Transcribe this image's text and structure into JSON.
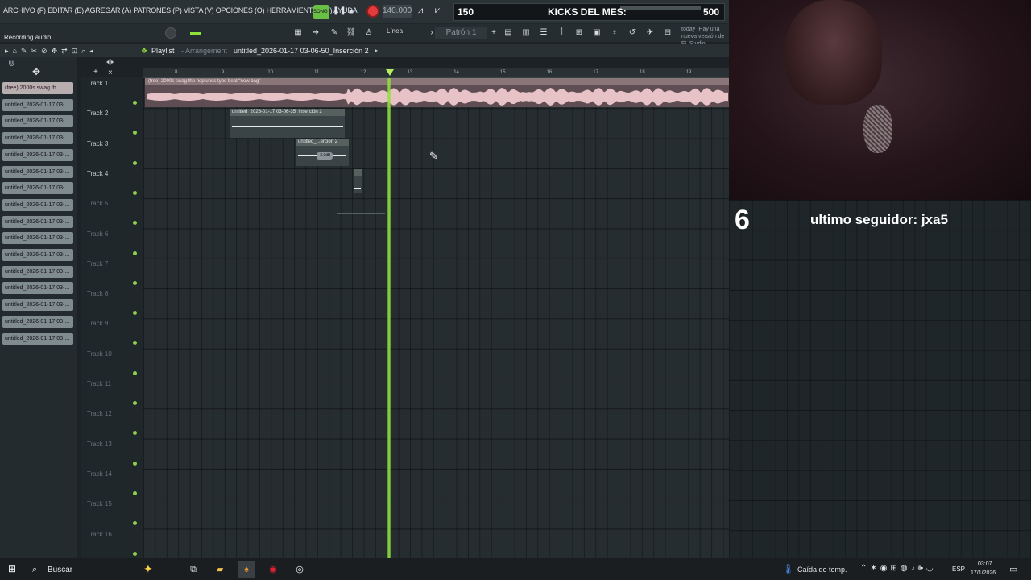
{
  "menu": {
    "items_text": "ARCHIVO (F) EDITAR (E) AGREGAR (A) PATRONES (P) VISTA (V) OPCIONES (O) HERRAMIENTAS (T) AYUDA"
  },
  "transport": {
    "song_label": "SONG",
    "pause_icon": "pause-icon",
    "stop_icon": "stop-icon",
    "tempo": "140.000"
  },
  "stream_overlay": {
    "goal_current": "150",
    "goal_title": "KICKS DEL MES:",
    "goal_target": "500",
    "counter": "6",
    "follower_text": "ultimo seguidor: jxa5"
  },
  "status": {
    "recording_text": "Recording audio"
  },
  "toolbar": {
    "line_mode": "Línea",
    "pattern": "Patrón 1",
    "hint_text": "today ¡Hay una nueva versión de FL Studio"
  },
  "playlist": {
    "title": "Playlist",
    "subtitle": "- Arrangement",
    "file": "untitled_2026-01-17 03-06-50_Inserción 2"
  },
  "picker_items": [
    "(free) 2000s swag th...",
    "untitled_2026-01-17 03-...",
    "untitled_2026-01-17 03-...",
    "untitled_2026-01-17 03-...",
    "untitled_2026-01-17 03-...",
    "untitled_2026-01-17 03-...",
    "untitled_2026-01-17 03-...",
    "untitled_2026-01-17 03-...",
    "untitled_2026-01-17 03-...",
    "untitled_2026-01-17 03-...",
    "untitled_2026-01-17 03-...",
    "untitled_2026-01-17 03-...",
    "untitled_2026-01-17 03-...",
    "untitled_2026-01-17 03-...",
    "untitled_2026-01-17 03-...",
    "untitled_2026-01-17 03-..."
  ],
  "tracks": [
    "Track 1",
    "Track 2",
    "Track 3",
    "Track 4",
    "Track 5",
    "Track 6",
    "Track 7",
    "Track 8",
    "Track 9",
    "Track 10",
    "Track 11",
    "Track 12",
    "Track 13",
    "Track 14",
    "Track 15",
    "Track 16"
  ],
  "ruler": [
    "8",
    "9",
    "10",
    "11",
    "12",
    "13",
    "14",
    "15",
    "16",
    "17",
    "18",
    "19"
  ],
  "clips": {
    "clip1": "(free) 2000s swag  the neptunes type beat  \"new bag\"",
    "clip2": "untitled_2026-01-17 03-06-35_Inserción 2",
    "clip3": "untitled_...erción 2",
    "clip3_gain": "-3.0dB"
  },
  "taskbar": {
    "search_label": "Buscar",
    "weather": "Caída de temp.",
    "lang": "ESP",
    "time": "03:07",
    "date": "17/1/2026"
  }
}
